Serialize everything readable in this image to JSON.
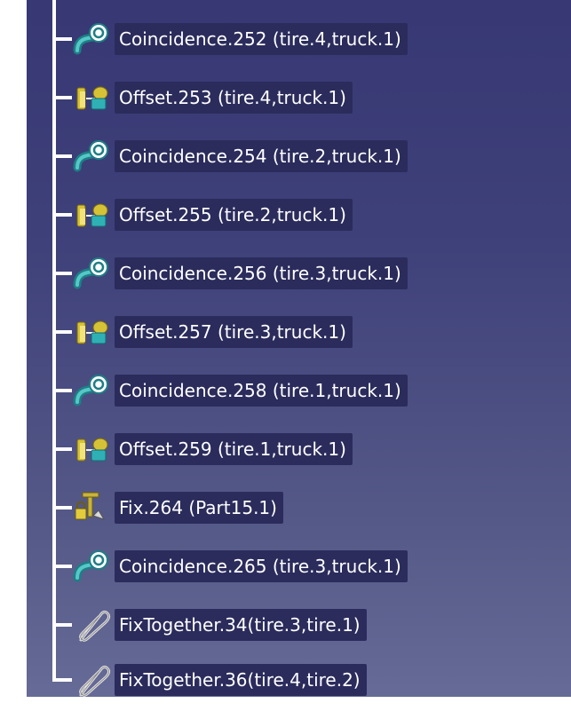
{
  "tree": {
    "items": [
      {
        "label": "Coincidence.252 (tire.4,truck.1)",
        "icon": "coincidence-icon"
      },
      {
        "label": "Offset.253 (tire.4,truck.1)",
        "icon": "offset-icon"
      },
      {
        "label": "Coincidence.254 (tire.2,truck.1)",
        "icon": "coincidence-icon"
      },
      {
        "label": "Offset.255 (tire.2,truck.1)",
        "icon": "offset-icon"
      },
      {
        "label": "Coincidence.256 (tire.3,truck.1)",
        "icon": "coincidence-icon"
      },
      {
        "label": "Offset.257 (tire.3,truck.1)",
        "icon": "offset-icon"
      },
      {
        "label": "Coincidence.258 (tire.1,truck.1)",
        "icon": "coincidence-icon"
      },
      {
        "label": "Offset.259 (tire.1,truck.1)",
        "icon": "offset-icon"
      },
      {
        "label": "Fix.264 (Part15.1)",
        "icon": "fix-anchor-icon"
      },
      {
        "label": "Coincidence.265 (tire.3,truck.1)",
        "icon": "coincidence-icon"
      },
      {
        "label": "FixTogether.34(tire.3,tire.1)",
        "icon": "paperclip-icon"
      },
      {
        "label": "FixTogether.36(tire.4,tire.2)",
        "icon": "paperclip-icon"
      }
    ]
  },
  "colors": {
    "background_top": "#373874",
    "background_bottom": "#686c98",
    "label_background": "#2b2c5c",
    "label_text": "#ffffff",
    "tree_lines": "#ffffff"
  }
}
